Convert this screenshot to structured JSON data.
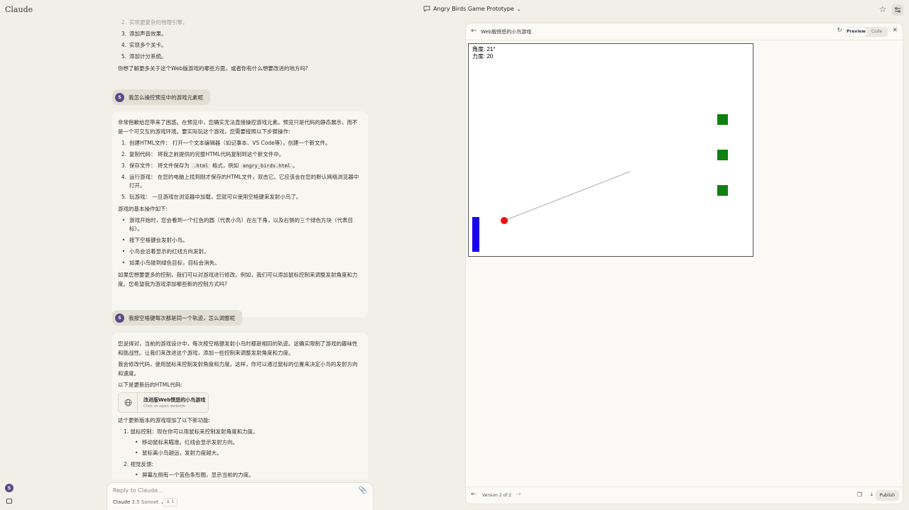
{
  "app": {
    "brand": "Claude",
    "project_title": "Angry Birds Game Prototype"
  },
  "chat": {
    "prev_items": [
      {
        "num": "2.",
        "text": "实现更复杂的物理引擎。"
      },
      {
        "num": "3.",
        "text": "添加声音效果。"
      },
      {
        "num": "4.",
        "text": "实现多个关卡。"
      },
      {
        "num": "5.",
        "text": "添加计分系统。"
      }
    ],
    "prev_question": "你想了解更多关于这个Web版游戏的哪些方面，或者你有什么想要改进的地方吗?",
    "user1": {
      "avatar": "S",
      "text": "我怎么操控预览中的游戏元素呢"
    },
    "ai1": {
      "intro": "非常抱歉给您带来了困惑。在预览中，您确实无法直接操控游戏元素。预览只是代码的静态展示，而不是一个可交互的游戏环境。要实际玩这个游戏，您需要按照以下步骤操作:",
      "steps": [
        {
          "num": "1.",
          "text": "创建HTML文件： 打开一个文本编辑器（如记事本、VS Code等），创建一个新文件。"
        },
        {
          "num": "2.",
          "text": "复制代码： 将我之前提供的完整HTML代码复制到这个新文件中。"
        },
        {
          "num": "4.",
          "text": "运行游戏： 在您的电脑上找到刚才保存的HTML文件，双击它。它应该会在您的默认网络浏览器中打开。"
        },
        {
          "num": "5.",
          "text": "玩游戏： 一旦游戏在浏览器中加载，您就可以使用空格键来发射小鸟了。"
        }
      ],
      "save_step": {
        "num": "3.",
        "pre": "保存文件： 将文件保存为 ",
        "code1": ".html",
        "mid": " 格式，例如 ",
        "code2": "angry_birds.html",
        "post": "。"
      },
      "ops_title": "游戏的基本操作如下:",
      "ops": [
        "游戏开始时，您会看到一个红色的圆（代表小鸟）在左下角，以及右侧的三个绿色方块（代表目标）。",
        "按下空格键会发射小鸟。",
        "小鸟会沿着显示的红线方向发射。",
        "如果小鸟碰到绿色目标，目标会消失。"
      ],
      "outro": "如果您想要更多的控制，我们可以对游戏进行修改。例如，我们可以添加鼠标控制来调整发射角度和力度。您希望我为游戏添加哪些新的控制方式吗?"
    },
    "user2": {
      "avatar": "S",
      "text": "我按空格键每次都是同一个轨迹，怎么调整呢"
    },
    "ai2": {
      "p1": "您说得对，当前的游戏设计中，每次按空格键发射小鸟时都是相同的轨迹。这确实限制了游戏的趣味性和挑战性。让我们来改进这个游戏，添加一些控制来调整发射角度和力度。",
      "p2": "我会修改代码，使用鼠标来控制发射角度和力度。这样，你可以通过鼠标的位置来决定小鸟的发射方向和速度。",
      "p3": "以下是更新后的HTML代码:",
      "artifact_title": "改进版Web愤怒的小鸟游戏",
      "artifact_sub": "Click to open website",
      "p4": "这个更新版本的游戏增加了以下新功能:",
      "f1": "1. 鼠标控制：现在你可以用鼠标来控制发射角度和力度。",
      "f1a": "移动鼠标来瞄准。红线会显示发射方向。",
      "f1b": "鼠标离小鸟越远，发射力度越大。",
      "f2": "2. 视觉反馈:",
      "f2a": "屏幕左侧有一个蓝色条形图，显示当前的力度。"
    }
  },
  "input": {
    "placeholder": "Reply to Claude...",
    "model": "Claude",
    "model_version": "3.5 Sonnet",
    "style_count": "1"
  },
  "sidebar": {
    "avatar": "S"
  },
  "panel": {
    "title": "Web版愤怒的小鸟游戏",
    "tab_preview": "Preview",
    "tab_code": "Code",
    "hud_angle": "角度: 21°",
    "hud_power": "力度: 20",
    "version": "Version 2 of 2",
    "publish": "Publish",
    "colors": {
      "bird": "#ee1111",
      "target": "#108010",
      "power_bar": "#1a00ee"
    }
  }
}
